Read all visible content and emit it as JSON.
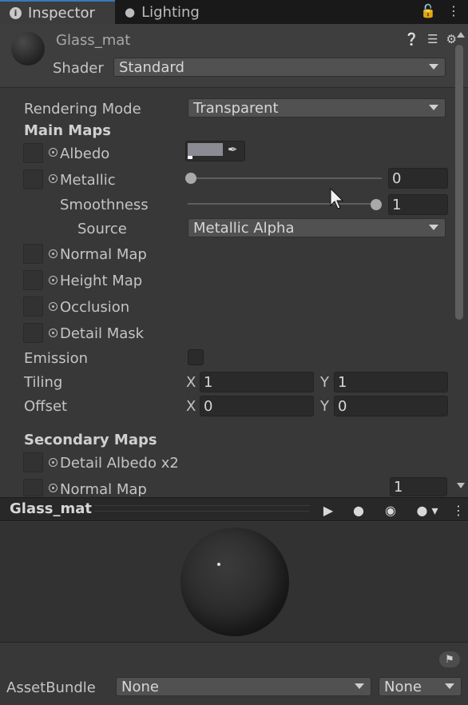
{
  "tabs": [
    {
      "label": "Inspector",
      "icon": "info-icon",
      "active": true
    },
    {
      "label": "Lighting",
      "icon": "lightbulb-icon",
      "active": false
    }
  ],
  "header": {
    "material_name": "Glass_mat",
    "shader_label": "Shader",
    "shader_value": "Standard"
  },
  "rendering": {
    "label": "Rendering Mode",
    "value": "Transparent"
  },
  "main_maps": {
    "title": "Main Maps",
    "albedo": "Albedo",
    "metallic": {
      "label": "Metallic",
      "value": "0",
      "slider": 0.0
    },
    "smoothness": {
      "label": "Smoothness",
      "value": "1",
      "slider": 1.0
    },
    "source": {
      "label": "Source",
      "value": "Metallic Alpha"
    },
    "normal_map": "Normal Map",
    "height_map": "Height Map",
    "occlusion": "Occlusion",
    "detail_mask": "Detail Mask",
    "emission": "Emission",
    "tiling": {
      "label": "Tiling",
      "x_label": "X",
      "x": "1",
      "y_label": "Y",
      "y": "1"
    },
    "offset": {
      "label": "Offset",
      "x_label": "X",
      "x": "0",
      "y_label": "Y",
      "y": "0"
    }
  },
  "secondary_maps": {
    "title": "Secondary Maps",
    "detail_albedo": "Detail Albedo x2",
    "normal_map": "Normal Map",
    "normal_value": "1"
  },
  "preview": {
    "title": "Glass_mat"
  },
  "asset_bundle": {
    "label": "AssetBundle",
    "bundle": "None",
    "variant": "None"
  },
  "colors": {
    "albedo_swatch": "#8b8c93",
    "accent_tab": "#3a79bb"
  }
}
